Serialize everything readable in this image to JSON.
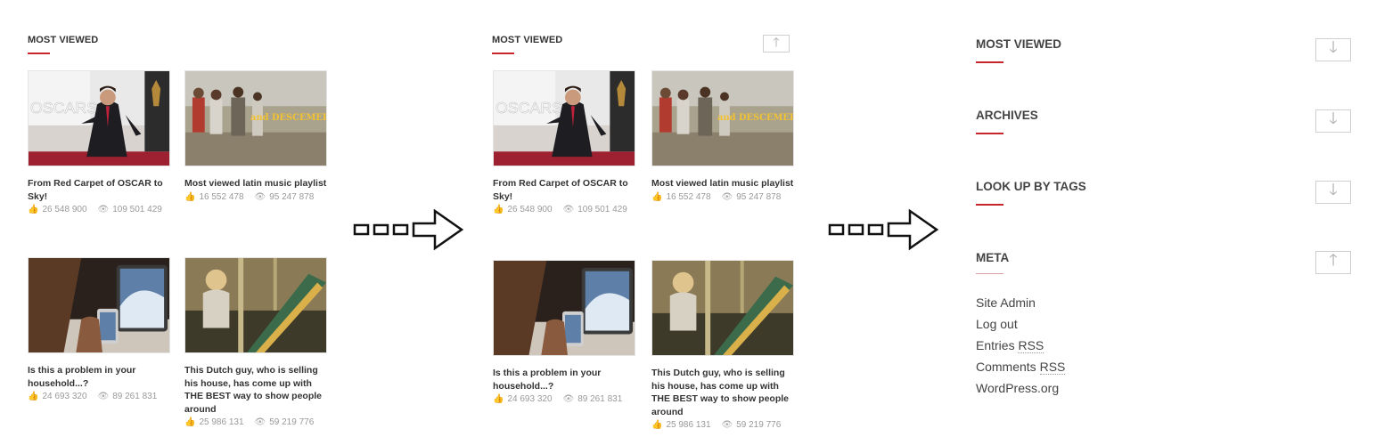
{
  "panel1": {
    "title": "MOST VIEWED",
    "cards": [
      {
        "title": "From Red Carpet of OSCAR to Sky!",
        "likes": "26 548 900",
        "views": "109 501 429",
        "overlay": "OSCARS"
      },
      {
        "title": "Most viewed latin music playlist",
        "likes": "16 552 478",
        "views": "95 247 878",
        "overlay": "and DESCEMER B"
      },
      {
        "title": "Is this a problem in your household...?",
        "likes": "24 693 320",
        "views": "89 261 831"
      },
      {
        "title": "This Dutch guy, who is selling his house, has come up with THE BEST way to show people around",
        "likes": "25 986 131",
        "views": "59 219 776"
      }
    ]
  },
  "panel2": {
    "title": "MOST VIEWED",
    "collapse_icon": "arrow-up-icon",
    "cards": [
      {
        "title": "From Red Carpet of OSCAR to Sky!",
        "likes": "26 548 900",
        "views": "109 501 429",
        "overlay": "OSCARS"
      },
      {
        "title": "Most viewed latin music playlist",
        "likes": "16 552 478",
        "views": "95 247 878",
        "overlay": "and DESCEMER B"
      },
      {
        "title": "Is this a problem in your household...?",
        "likes": "24 693 320",
        "views": "89 261 831"
      },
      {
        "title": "This Dutch guy, who is selling his house, has come up with THE BEST way to show people around",
        "likes": "25 986 131",
        "views": "59 219 776"
      }
    ]
  },
  "panel3": {
    "sections": [
      {
        "title": "MOST VIEWED",
        "icon": "arrow-down-icon"
      },
      {
        "title": "ARCHIVES",
        "icon": "arrow-down-icon"
      },
      {
        "title": "LOOK UP BY TAGS",
        "icon": "arrow-down-icon"
      },
      {
        "title": "META",
        "icon": "arrow-up-icon"
      }
    ],
    "meta_links": {
      "site_admin": "Site Admin",
      "log_out": "Log out",
      "entries": "Entries",
      "entries_abbr": "RSS",
      "comments": "Comments",
      "comments_abbr": "RSS",
      "wordpress": "WordPress.org"
    }
  },
  "colors": {
    "accent": "#c9262c",
    "text": "#333333",
    "muted": "#999999"
  }
}
